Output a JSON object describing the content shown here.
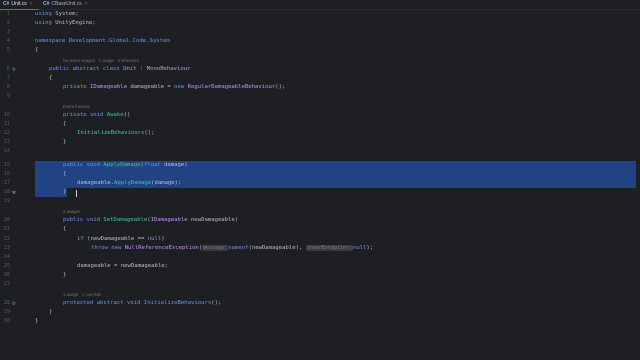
{
  "tabs": [
    {
      "lang": "C#",
      "label": "Unit.cs",
      "close": "×"
    },
    {
      "lang": "C#",
      "label": "CBaseUnit.cs",
      "close": "×"
    }
  ],
  "hints": {
    "unit_class": "No asset usages   1 usage   4 inheritors",
    "awake": "Event function",
    "setdamageable": "2 usages",
    "initialize": "1 usage   1 override"
  },
  "line_numbers": [
    "1",
    "2",
    "3",
    "4",
    "5",
    "6",
    "7",
    "8",
    "9",
    "10",
    "11",
    "12",
    "13",
    "14",
    "15",
    "16",
    "17",
    "18",
    "19",
    "20",
    "21",
    "22",
    "23",
    "24",
    "25",
    "26",
    "27",
    "28",
    "29",
    "30"
  ],
  "code": {
    "l1_kw": "using",
    "l1_ns": "System;",
    "l2_kw": "using",
    "l2_ns": "UnityEngine;",
    "l4_kw": "namespace",
    "l4_ns": "Development.Global.Code.System",
    "l5": "{",
    "l6_kw": "public abstract class",
    "l6_ty": "Unit",
    "l6_sep": ":",
    "l6_base": "MonoBehaviour",
    "l7": "{",
    "l8_kw": "private",
    "l8_ifc": "IDamageable",
    "l8_var": "damageable =",
    "l8_new": "new",
    "l8_ty": "RegularDamageableBehaviour",
    "l8_end": "();",
    "l10_kw": "private void",
    "l10_fn": "Awake",
    "l10_end": "()",
    "l11": "{",
    "l12_fn": "InitializeBehaviours",
    "l12_end": "();",
    "l13": "}",
    "l15_kw": "public void",
    "l15_fn": "ApplyDamage",
    "l15_p1": "(",
    "l15_t": "float",
    "l15_p2": "damage)",
    "l16": "{",
    "l17_var": "damageable.",
    "l17_fn": "ApplyDamage",
    "l17_end": "(damage);",
    "l18": "}",
    "l20_kw": "public void",
    "l20_fn": "SetDamageable",
    "l20_p1": "(",
    "l20_ifc": "IDamageable",
    "l20_p2": "newDamageable)",
    "l21": "{",
    "l22_kw": "if",
    "l22_a": "(newDamageable",
    "l22_op": "==",
    "l22_null": "null",
    "l22_end": ")",
    "l23_kw": "throw new",
    "l23_ty": "NullReferenceException",
    "l23_p": "(",
    "l23_h1": "message:",
    "l23_kw2": "nameof",
    "l23_b": "(newDamageable),",
    "l23_h2": "innerException:",
    "l23_null": "null",
    "l23_end": ");",
    "l25_var": "damageable = newDamageable;",
    "l26": "}",
    "l28_kw": "protected abstract void",
    "l28_fn": "InitializeBehaviours",
    "l28_end": "();",
    "l29": "}",
    "l30": "}"
  },
  "colors": {
    "selection": "#214283",
    "background": "#1e1f22",
    "accent": "#3574f0"
  },
  "icons": [
    "implement-icon",
    "inheritance-icon",
    "hammer-icon"
  ]
}
